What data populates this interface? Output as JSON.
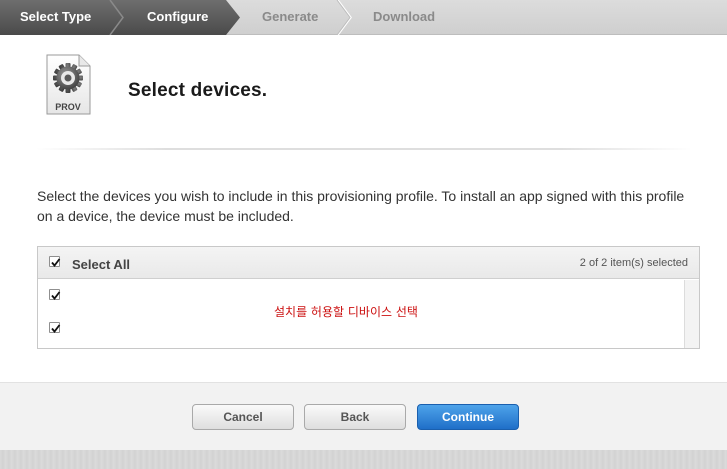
{
  "stepper": {
    "steps": [
      {
        "label": "Select Type",
        "state": "done"
      },
      {
        "label": "Configure",
        "state": "current"
      },
      {
        "label": "Generate",
        "state": "todo"
      },
      {
        "label": "Download",
        "state": "todo"
      }
    ]
  },
  "header": {
    "icon_label": "PROV",
    "icon": "provisioning-profile-gear-icon",
    "title": "Select devices."
  },
  "description": "Select the devices you wish to include in this provisioning profile. To install an app signed with this profile on a device, the device must be included.",
  "device_table": {
    "select_all_label": "Select All",
    "select_all_checked": true,
    "selection_count": "2 of 2 item(s) selected",
    "rows": [
      {
        "checked": true,
        "name": ""
      },
      {
        "checked": true,
        "name": ""
      }
    ],
    "annotation": "설치를 허용할 디바이스 선택"
  },
  "footer": {
    "cancel_label": "Cancel",
    "back_label": "Back",
    "continue_label": "Continue"
  },
  "colors": {
    "accent_blue": "#2a7fd4",
    "annotation_red": "#cc1111",
    "stepper_dark": "#5a5a5a"
  }
}
